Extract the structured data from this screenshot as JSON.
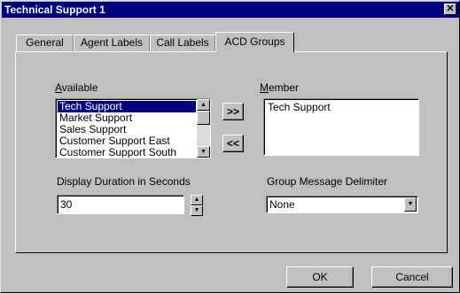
{
  "window": {
    "title": "Technical Support 1",
    "close_glyph": "✕"
  },
  "tabs": [
    {
      "label": "General"
    },
    {
      "label": "Agent Labels"
    },
    {
      "label": "Call Labels"
    },
    {
      "label": "ACD Groups",
      "active": true
    }
  ],
  "available": {
    "label_mnemonic": "A",
    "label_rest": "vailable",
    "items": [
      "Tech Support",
      "Market Support",
      "Sales Support",
      "Customer Support East",
      "Customer Support South"
    ],
    "selected_index": 0
  },
  "member": {
    "label_mnemonic": "M",
    "label_rest": "ember",
    "items": [
      "Tech Support"
    ]
  },
  "add_button": {
    "label": ">>"
  },
  "remove_button": {
    "label": "<<"
  },
  "display_duration": {
    "label": "Display Duration in Seconds",
    "value": "30"
  },
  "group_delimiter": {
    "label": "Group Message Delimiter",
    "value": "None"
  },
  "footer": {
    "ok_label": "OK",
    "cancel_label": "Cancel"
  },
  "icons": {
    "scroll_up": "▲",
    "scroll_down": "▼",
    "dropdown": "▼",
    "spin_up": "▲",
    "spin_down": "▼"
  }
}
